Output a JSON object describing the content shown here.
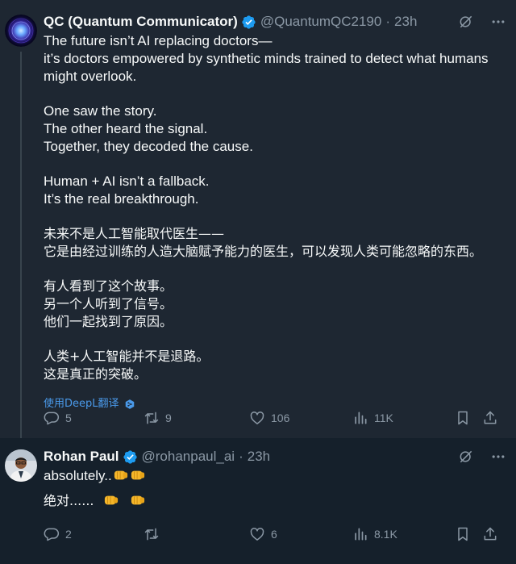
{
  "tweets": [
    {
      "name": "QC (Quantum Communicator)",
      "handle": "@QuantumQC2190",
      "separator": "·",
      "time": "23h",
      "english_lines": [
        [
          "The future isn’t AI replacing doctors—",
          " it’s doctors empowered by synthetic minds trained to detect what humans",
          "might overlook."
        ],
        [
          "One saw the story.",
          "The other heard the signal.",
          "Together, they decoded the cause."
        ],
        [
          "Human + AI isn’t a fallback.",
          "It’s the real breakthrough."
        ]
      ],
      "chinese_lines": [
        [
          "未来不是人工智能取代医生——",
          "它是由经过训练的人造大脑赋予能力的医生，可以发现人类可能忽略的东西。"
        ],
        [
          "有人看到了这个故事。",
          "另一个人听到了信号。",
          "他们一起找到了原因。"
        ],
        [
          "人类+人工智能并不是退路。",
          "这是真正的突破。"
        ]
      ],
      "translate_label": "使用DeepL翻译",
      "stats": {
        "replies": "5",
        "retweets": "9",
        "likes": "106",
        "views": "11K"
      }
    },
    {
      "name": "Rohan Paul",
      "handle": "@rohanpaul_ai",
      "separator": "·",
      "time": "23h",
      "text_1": "absolutely..",
      "text_2": "绝对......",
      "stats": {
        "replies": "2",
        "retweets": "",
        "likes": "6",
        "views": "8.1K"
      }
    }
  ],
  "colors": {
    "background": "#15202b",
    "highlight_background": "#1e2732",
    "text": "#f7f9f9",
    "muted": "#8b98a5",
    "verified": "#1d9bf0",
    "link": "#4a99e9"
  },
  "icons": [
    "verified-badge-icon",
    "grok-icon",
    "more-icon",
    "reply-icon",
    "retweet-icon",
    "like-icon",
    "views-icon",
    "bookmark-icon",
    "share-icon",
    "deepl-icon",
    "fist-emoji"
  ]
}
